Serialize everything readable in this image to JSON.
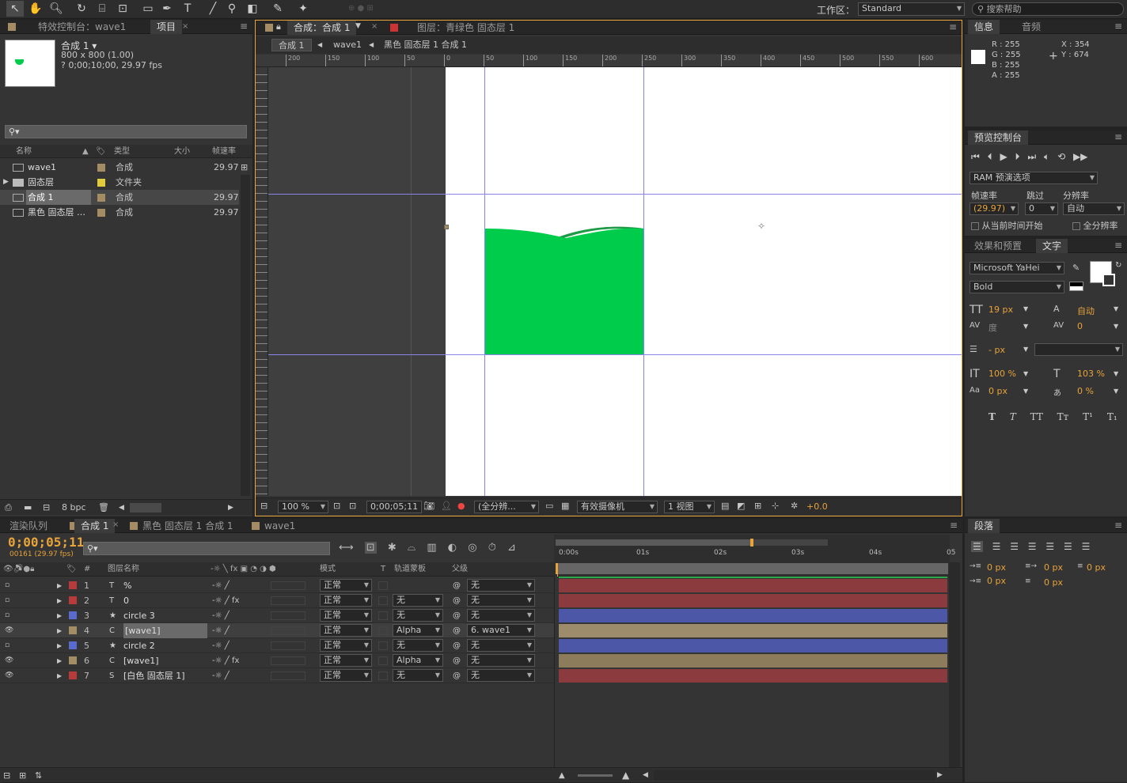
{
  "toolbar": {
    "workspace_label": "工作区：",
    "workspace_value": "Standard",
    "search_placeholder": "搜索帮助"
  },
  "project": {
    "tabs": [
      "特效控制台：wave1",
      "项目"
    ],
    "comp_name": "合成 1 ▾",
    "comp_size": "800 x 800 (1.00)",
    "comp_time": "? 0;00;10;00, 29.97 fps",
    "cols": {
      "name": "名称",
      "type": "类型",
      "size": "大小",
      "fps": "帧速率"
    },
    "items": [
      {
        "name": "wave1",
        "type": "合成",
        "fps": "29.97",
        "color": "#a48c64"
      },
      {
        "name": "固态层",
        "type": "文件夹",
        "fps": "",
        "color": "#e0cc3a"
      },
      {
        "name": "合成 1",
        "type": "合成",
        "fps": "29.97",
        "color": "#a48c64"
      },
      {
        "name": "黑色 固态层 …",
        "type": "合成",
        "fps": "29.97",
        "color": "#a48c64"
      }
    ],
    "bpc": "8 bpc"
  },
  "viewer": {
    "tabs": [
      "合成：合成 1",
      "图层：青绿色 固态层 1"
    ],
    "breadcrumbs": [
      "合成 1",
      "wave1",
      "黑色 固态层 1 合成 1"
    ],
    "ruler_labels": [
      "200",
      "150",
      "100",
      "50",
      "0",
      "50",
      "100",
      "150",
      "200",
      "250",
      "300",
      "350",
      "400",
      "450",
      "500",
      "550",
      "600"
    ],
    "zoom": "100 %",
    "timecode": "0;00;05;11",
    "resolution": "(全分辨...",
    "camera": "有效摄像机",
    "views": "1 视图",
    "exposure": "+0.0",
    "wave_color": "#00cc4c",
    "wave_dark": "#1f9a46"
  },
  "info": {
    "tabs": [
      "信息",
      "音频"
    ],
    "r": "R : 255",
    "g": "G : 255",
    "b": "B : 255",
    "a": "A : 255",
    "x": "X : 354",
    "y": "Y : 674"
  },
  "preview": {
    "tab": "预览控制台",
    "ram": "RAM 预演选项",
    "framerate_label": "帧速率",
    "skip_label": "跳过",
    "res_label": "分辨率",
    "framerate": "(29.97)",
    "skip": "0",
    "res": "自动",
    "from_current": "从当前时间开始",
    "full_res": "全分辨率"
  },
  "text": {
    "tabs": [
      "效果和预置",
      "文字"
    ],
    "font": "Microsoft YaHei",
    "style": "Bold",
    "size": "19 px",
    "leading": "自动",
    "tracking": "0",
    "stroke": "- px",
    "vscale": "100 %",
    "hscale": "103 %",
    "baseline": "0 px",
    "tsume": "0 %",
    "kern": "度",
    "styles": [
      "T",
      "T",
      "TT",
      "Tт",
      "T¹",
      "T₁"
    ]
  },
  "paragraph": {
    "tab": "段落",
    "indent": [
      "0 px",
      "0 px",
      "0 px"
    ],
    "space": [
      "0 px",
      "0 px"
    ]
  },
  "timeline": {
    "tabs": [
      "渲染队列",
      "合成 1",
      "黑色 固态层 1 合成 1",
      "wave1"
    ],
    "timecode": "0;00;05;11",
    "frame_info": "00161 (29.97 fps)",
    "cols": {
      "num": "#",
      "name": "图层名称",
      "mode": "模式",
      "t": "T",
      "trkmat": "轨道蒙板",
      "parent": "父级"
    },
    "time_labels": [
      "0:00s",
      "01s",
      "02s",
      "03s",
      "04s",
      "05"
    ],
    "layers": [
      {
        "num": "1",
        "name": "%",
        "type": "T",
        "mode": "正常",
        "trk": "",
        "parent": "无",
        "color": "#b83a3a",
        "bar": "#8b3a3e",
        "eye": false,
        "fx": false
      },
      {
        "num": "2",
        "name": "0",
        "type": "T",
        "mode": "正常",
        "trk": "无",
        "parent": "无",
        "color": "#b83a3a",
        "bar": "#8b3a3e",
        "eye": false,
        "fx": true
      },
      {
        "num": "3",
        "name": "circle 3",
        "type": "★",
        "mode": "正常",
        "trk": "无",
        "parent": "无",
        "color": "#5a6bd0",
        "bar": "#4d57a8",
        "eye": false,
        "fx": false
      },
      {
        "num": "4",
        "name": "[wave1]",
        "type": "C",
        "mode": "正常",
        "trk": "Alpha",
        "parent": "6. wave1",
        "color": "#a48c64",
        "bar": "#9c8c6c",
        "eye": true,
        "fx": false
      },
      {
        "num": "5",
        "name": "circle 2",
        "type": "★",
        "mode": "正常",
        "trk": "无",
        "parent": "无",
        "color": "#5a6bd0",
        "bar": "#4d57a8",
        "eye": false,
        "fx": false
      },
      {
        "num": "6",
        "name": "[wave1]",
        "type": "C",
        "mode": "正常",
        "trk": "Alpha",
        "parent": "无",
        "color": "#a48c64",
        "bar": "#8c7c5c",
        "eye": true,
        "fx": true
      },
      {
        "num": "7",
        "name": "[白色 固态层 1]",
        "type": "S",
        "mode": "正常",
        "trk": "无",
        "parent": "无",
        "color": "#b83a3a",
        "bar": "#8b3a3e",
        "eye": true,
        "fx": false
      }
    ]
  }
}
